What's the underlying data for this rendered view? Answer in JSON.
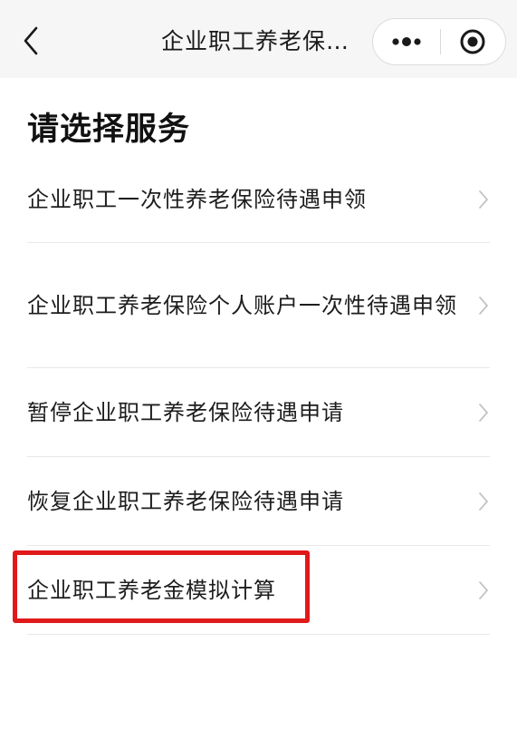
{
  "navbar": {
    "title": "企业职工养老保…",
    "more_glyph": "•••"
  },
  "colors": {
    "highlight": "#e0191b",
    "background": "#f6f6f7",
    "divider": "#e8e8e8"
  },
  "page": {
    "heading": "请选择服务",
    "items": [
      {
        "label": "企业职工一次性养老保险待遇申领"
      },
      {
        "label": "企业职工养老保险个人账户一次性待遇申领"
      },
      {
        "label": "暂停企业职工养老保险待遇申请"
      },
      {
        "label": "恢复企业职工养老保险待遇申请"
      },
      {
        "label": "企业职工养老金模拟计算",
        "highlighted": true
      }
    ]
  }
}
